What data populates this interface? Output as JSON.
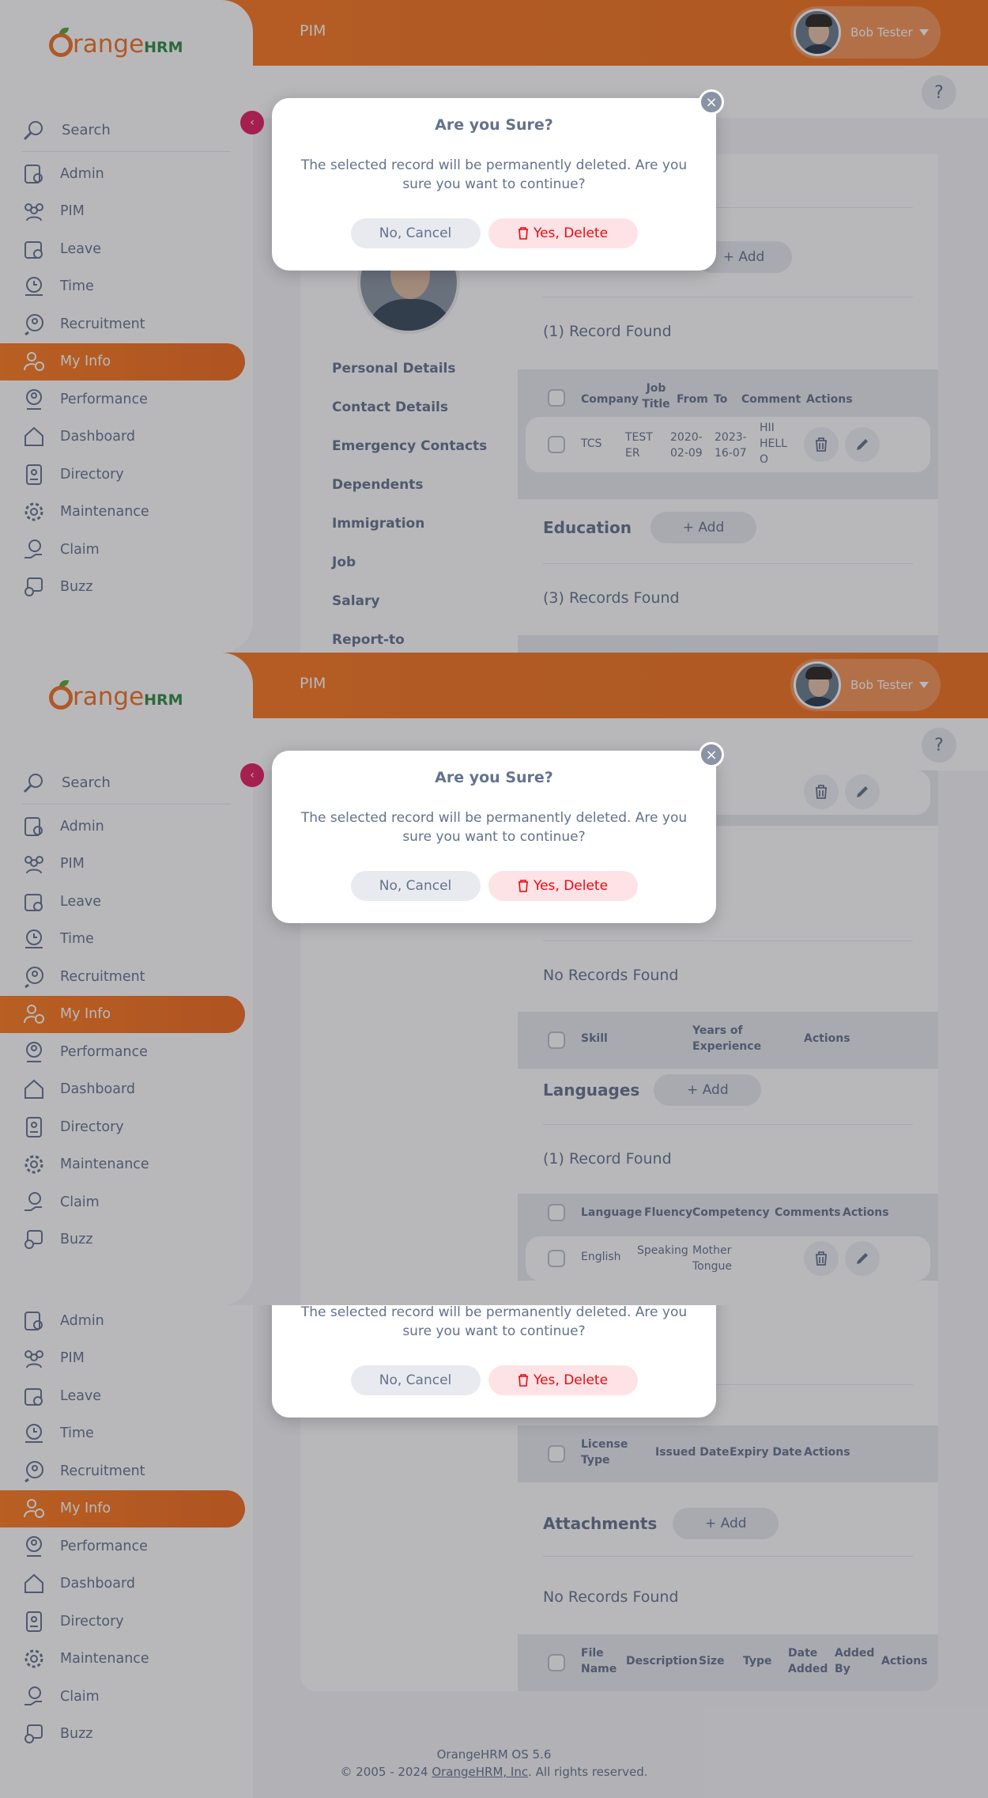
{
  "topbar": {
    "module": "PIM",
    "user_name": "Bob Tester"
  },
  "help": {
    "label": "?"
  },
  "logo": {
    "text": "range",
    "hrm": "HRM"
  },
  "sidebar": {
    "search_label": "Search",
    "collapse_label": "‹",
    "items": [
      {
        "label": "Admin",
        "icon": "admin-icon"
      },
      {
        "label": "PIM",
        "icon": "pim-icon"
      },
      {
        "label": "Leave",
        "icon": "leave-icon"
      },
      {
        "label": "Time",
        "icon": "time-icon"
      },
      {
        "label": "Recruitment",
        "icon": "recruitment-icon"
      },
      {
        "label": "My Info",
        "icon": "myinfo-icon",
        "active": true
      },
      {
        "label": "Performance",
        "icon": "performance-icon"
      },
      {
        "label": "Dashboard",
        "icon": "dashboard-icon"
      },
      {
        "label": "Directory",
        "icon": "directory-icon"
      },
      {
        "label": "Maintenance",
        "icon": "maintenance-icon"
      },
      {
        "label": "Claim",
        "icon": "claim-icon"
      },
      {
        "label": "Buzz",
        "icon": "buzz-icon"
      }
    ]
  },
  "tabs": [
    "Personal Details",
    "Contact Details",
    "Emergency Contacts",
    "Dependents",
    "Immigration",
    "Job",
    "Salary",
    "Report-to"
  ],
  "work_experience": {
    "add_label": "+ Add",
    "records": "(1) Record Found",
    "headers": [
      "Company",
      "Job Title",
      "From",
      "To",
      "Comment",
      "Actions"
    ],
    "row": [
      "TCS",
      "TEST ER",
      "2020-02-09",
      "2023-16-07",
      "HII HELL O"
    ]
  },
  "education": {
    "title": "Education",
    "add_label": "+ Add",
    "records": "(3) Records Found"
  },
  "skills": {
    "records": "No Records Found",
    "headers": [
      "Skill",
      "Years of Experience",
      "Actions"
    ]
  },
  "languages": {
    "title": "Languages",
    "add_label": "+ Add",
    "records": "(1) Record Found",
    "headers": [
      "Language",
      "Fluency",
      "Competency",
      "Comments",
      "Actions"
    ],
    "row": [
      "English",
      "Speaking",
      "Mother Tongue"
    ]
  },
  "license": {
    "headers": [
      "License Type",
      "Issued Date",
      "Expiry Date",
      "Actions"
    ]
  },
  "attachments": {
    "title": "Attachments",
    "add_label": "+ Add",
    "records": "No Records Found",
    "headers": [
      "File Name",
      "Description",
      "Size",
      "Type",
      "Date Added",
      "Added By",
      "Actions"
    ]
  },
  "modal": {
    "title": "Are you Sure?",
    "text": "The selected record will be permanently deleted. Are you sure you want to continue?",
    "cancel_label": "No, Cancel",
    "delete_label": "Yes, Delete",
    "close_label": "×"
  },
  "footer": {
    "version": "OrangeHRM OS 5.6",
    "copyright_pre": "© 2005 - 2024 ",
    "company": "OrangeHRM, Inc",
    "copyright_post": ". All rights reserved."
  },
  "colors": {
    "brand": "#ff7b1d",
    "danger": "#eb0910",
    "text": "#64728c"
  }
}
